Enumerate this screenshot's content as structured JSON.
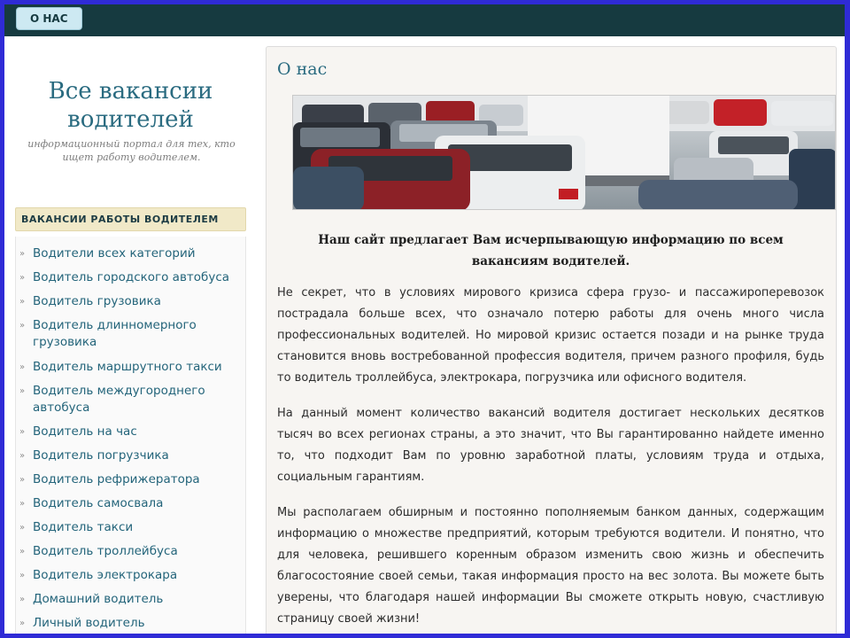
{
  "nav": {
    "about_label": "О НАС"
  },
  "sidebar": {
    "site_title": "Все вакансии водителей",
    "site_subtitle": "информационный портал для тех, кто ищет работу водителем.",
    "category_header": "ВАКАНСИИ РАБОТЫ ВОДИТЕЛЕМ",
    "categories": [
      "Водители всех категорий",
      "Водитель городского автобуса",
      "Водитель грузовика",
      "Водитель длинномерного грузовика",
      "Водитель маршрутного такси",
      "Водитель междугороднего автобуса",
      "Водитель на час",
      "Водитель погрузчика",
      "Водитель рефрижератора",
      "Водитель самосвала",
      "Водитель такси",
      "Водитель троллейбуса",
      "Водитель электрокара",
      "Домашний водитель",
      "Личный водитель"
    ]
  },
  "main": {
    "title": "О нас",
    "lead": "Наш сайт предлагает Вам исчерпывающую информацию по всем вакансиям водителей.",
    "paragraphs": [
      "Не секрет, что в условиях мирового кризиса сфера грузо- и пассажироперевозок пострадала больше всех, что означало потерю работы для очень много числа профессиональных водителей. Но мировой кризис остается позади и на рынке труда становится вновь востребованной профессия водителя, причем разного профиля, будь то водитель троллейбуса, электрокара, погрузчика или офисного водителя.",
      "На данный момент количество вакансий водителя достигает нескольких десятков тысяч во всех регионах страны, а это значит, что Вы гарантированно найдете именно то, что подходит Вам по уровню заработной платы, условиям труда и отдыха, социальным гарантиям.",
      "Мы располагаем обширным и постоянно пополняемым банком данных, содержащим информацию о множестве предприятий, которым требуются водители. И понятно, что для человека, решившего коренным образом изменить свою жизнь и обеспечить благосостояние своей семьи, такая информация просто на вес золота. Вы можете быть уверены, что благодаря нашей информации Вы сможете открыть новую, счастливую страницу своей жизни!"
    ]
  },
  "colors": {
    "topbar": "#163a40",
    "accent": "#2a6b80",
    "frame": "#2f2bd6",
    "category_header_bg": "#f1e9c8"
  }
}
